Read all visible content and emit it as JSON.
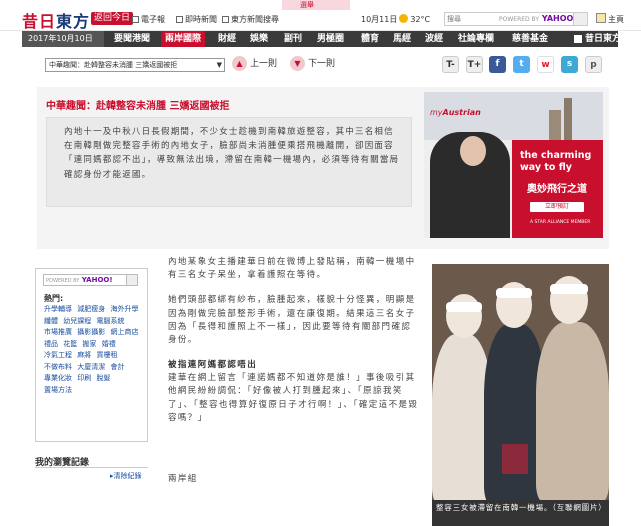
{
  "header": {
    "logo_main": "昔日",
    "logo_east": "東方",
    "back_today": "返回今日",
    "links": [
      "電子報",
      "即時新聞",
      "東方新聞搜尋"
    ],
    "banner_text": "選舉",
    "date_weather": "10月11日",
    "temperature": "32°C",
    "search_placeholder": "搜尋",
    "search_brand": "YAHOO!",
    "search_powered": "POWERED BY",
    "home_label": "主頁"
  },
  "nav": {
    "date": "2017年10月10日 (二)",
    "items": [
      "要聞港聞",
      "兩岸國際",
      "財經",
      "娛樂",
      "副刊",
      "男極圈",
      "體育",
      "馬經",
      "波經",
      "社論專欄",
      "慈善基金",
      "昔日東方"
    ],
    "active_index": 1
  },
  "toolbar": {
    "category": "中華趣聞：赴韓整容未消腫 三嬌返國被拒",
    "category_arrow": "▼",
    "prev_label": "上一則",
    "next_label": "下一則",
    "prev_arrow": "▲",
    "next_arrow": "▼",
    "font_down": "T-",
    "font_up": "T+",
    "icons": [
      "facebook-icon",
      "twitter-icon",
      "weibo-icon",
      "print-icon"
    ]
  },
  "article": {
    "headline": "中華趣聞：赴韓整容未消腫 三嬌返國被拒",
    "summary": "內地十一及中秋八日長假期間，不少女士趁機到南韓旅遊整容，其中三名相信在南韓剛做完整容手術的內地女子，臉部尚未消腫便乘搭飛機離開，卻因面容「連同媽都認不出」，導致無法出境，滯留在南韓一機場內，必須等待有關當局確認身份才能返國。",
    "para1": "內地某象女主播建華日前在微博上發貼稱，南韓一機場中有三名女子呆坐，拿着護照在等待。",
    "para2": "她們頭部都綁有紗布，臉腫起來，樣貌十分怪異，明顯是因為剛做完臉部整形手術，還在康復期。結果這三名女子因為「長得和護照上不一樣」，因此要等待有關部門確認身份。",
    "subhead": "被指連阿媽都認唔出",
    "para3": "建華在網上留言「連諾媽都不知道妳是誰！」事後吸引其他網民紛紛調侃：「好像被人打到腫起來」、「原諒我笑了」、「整容也得算好復原日子才行啊！」、「確定這不是毀容嗎？」",
    "author": "兩岸組",
    "photo_caption": "整容三女被滯留在南韓一機場。（互聯網圖片）"
  },
  "ad": {
    "brand_prefix": "my",
    "brand": "Austrian",
    "headline": "the charming way to fly",
    "headline_cn": "奧妙飛行之道",
    "cta": "立即預訂",
    "alliance": "A STAR ALLIANCE MEMBER"
  },
  "sidebar": {
    "search_brand": "YAHOO!",
    "search_powered": "POWERED BY",
    "hot_label": "熱門:",
    "hot_links": [
      "升學輔導",
      "減肥瘦身",
      "海外升學",
      "纖體",
      "幼兒課程",
      "電腦系統",
      "市場推廣",
      "攝影攝影",
      "網上商店",
      "禮品",
      "花籃",
      "搬家",
      "婚禮",
      "冷氣工程",
      "麻將",
      "買樓租",
      "不做布料",
      "大廈清潔",
      "會計",
      "專業化妝",
      "印刷",
      "脫髮",
      "置場方法"
    ],
    "browse_title": "我的瀏覽記錄",
    "clear_label": "清除紀錄"
  },
  "colors": {
    "brand_red": "#c8102e",
    "nav_dark": "#3a3a3a",
    "link_blue": "#1a4fa0"
  }
}
